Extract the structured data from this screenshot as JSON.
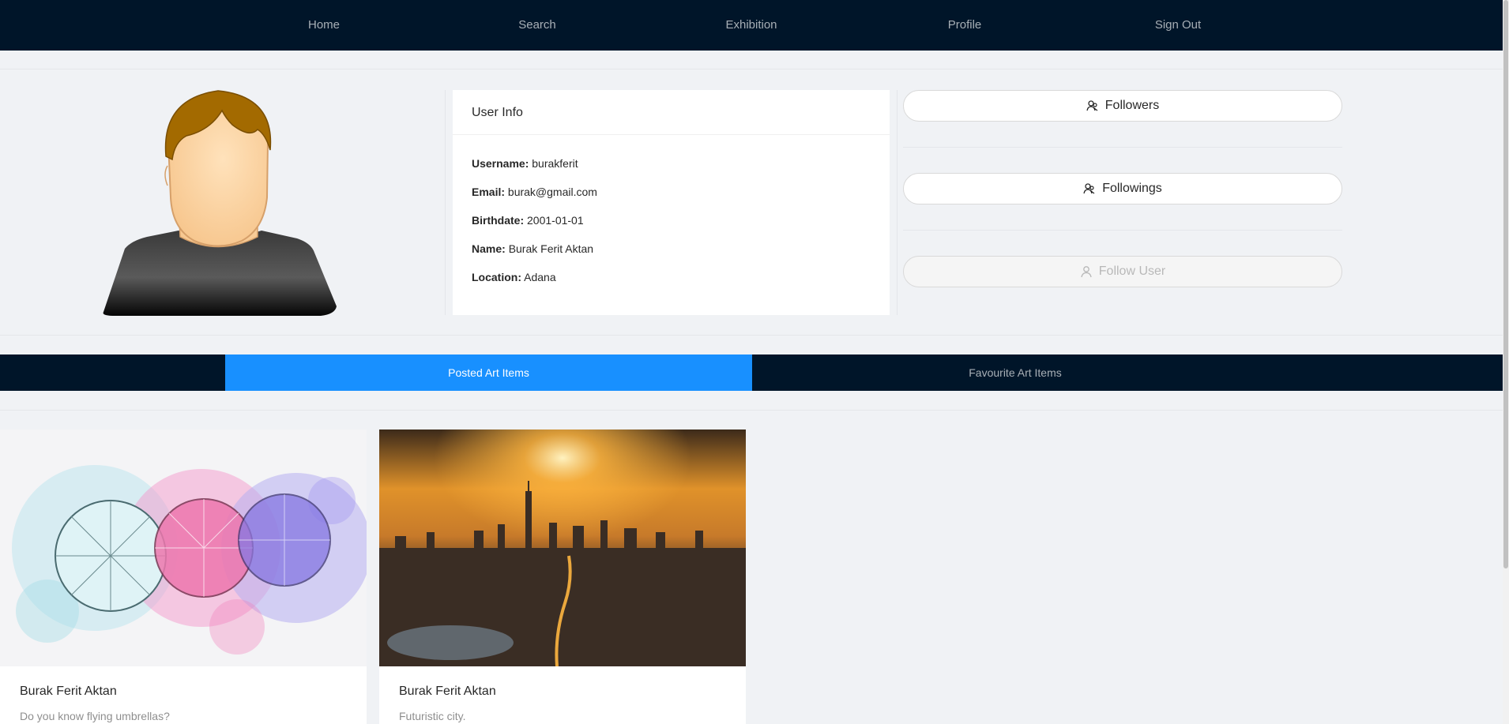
{
  "nav": {
    "items": [
      {
        "label": "Home"
      },
      {
        "label": "Search"
      },
      {
        "label": "Exhibition"
      },
      {
        "label": "Profile"
      },
      {
        "label": "Sign Out"
      }
    ]
  },
  "user_info": {
    "title": "User Info",
    "fields": [
      {
        "label": "Username:",
        "value": "burakferit"
      },
      {
        "label": "Email:",
        "value": "burak@gmail.com"
      },
      {
        "label": "Birthdate:",
        "value": "2001-01-01"
      },
      {
        "label": "Name:",
        "value": "Burak Ferit Aktan"
      },
      {
        "label": "Location:",
        "value": "Adana"
      }
    ]
  },
  "actions": {
    "followers": "Followers",
    "followings": "Followings",
    "follow_user": "Follow User"
  },
  "tabs": [
    {
      "label": "Posted Art Items",
      "active": true
    },
    {
      "label": "Favourite Art Items",
      "active": false
    }
  ],
  "art_items": [
    {
      "title": "Burak Ferit Aktan",
      "description": "Do you know flying umbrellas?",
      "image": "umbrellas-watercolor"
    },
    {
      "title": "Burak Ferit Aktan",
      "description": "Futuristic city.",
      "image": "city-sunset"
    }
  ],
  "colors": {
    "nav_bg": "#001529",
    "tab_active": "#1890ff",
    "page_bg": "#f0f2f5"
  }
}
